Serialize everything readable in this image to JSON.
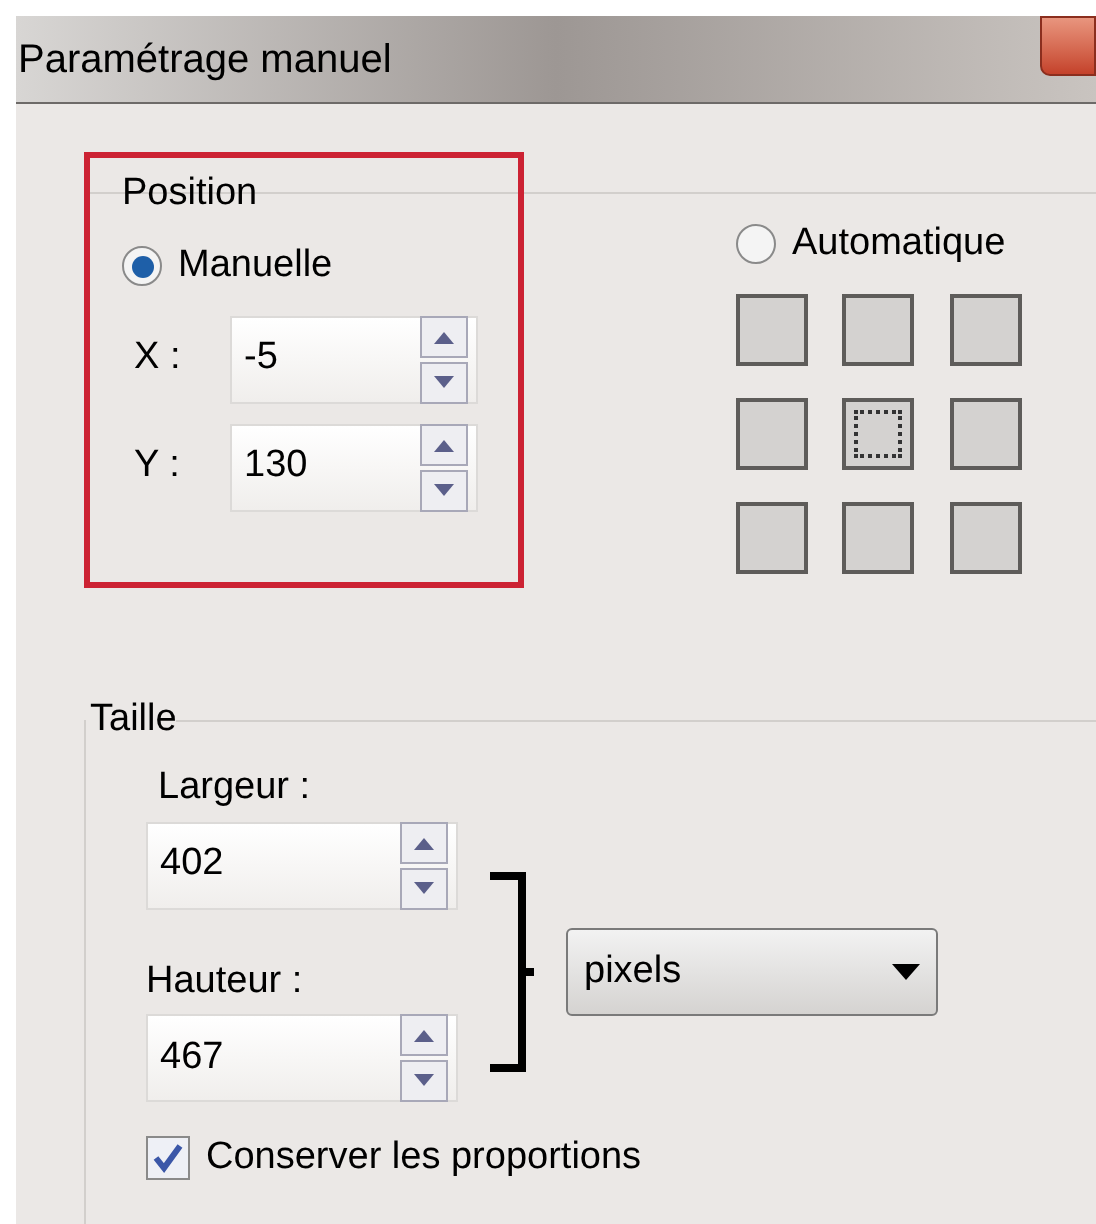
{
  "window": {
    "title": "Paramétrage manuel"
  },
  "position": {
    "title": "Position",
    "modes": [
      {
        "label": "Manuelle",
        "selected": true
      },
      {
        "label": "Automatique",
        "selected": false
      }
    ],
    "fields": [
      {
        "label": "X :",
        "value": "-5"
      },
      {
        "label": "Y :",
        "value": "130"
      }
    ],
    "anchor_grid": [
      {
        "selected": false
      },
      {
        "selected": false
      },
      {
        "selected": false
      },
      {
        "selected": false
      },
      {
        "selected": true
      },
      {
        "selected": false
      },
      {
        "selected": false
      },
      {
        "selected": false
      },
      {
        "selected": false
      }
    ]
  },
  "size": {
    "title": "Taille",
    "fields": [
      {
        "label": "Largeur :",
        "value": "402"
      },
      {
        "label": "Hauteur :",
        "value": "467"
      }
    ],
    "unit": "pixels",
    "keep_proportions": {
      "label": "Conserver les proportions",
      "checked": true
    }
  }
}
